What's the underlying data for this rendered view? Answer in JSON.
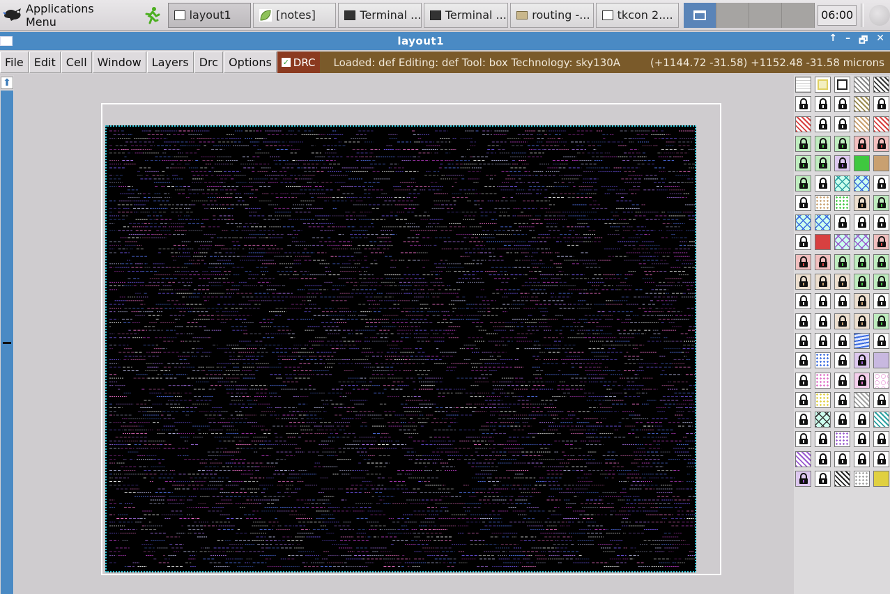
{
  "taskbar": {
    "apps_menu_label": "Applications Menu",
    "tasks": [
      {
        "label": "layout1",
        "icon": "window-icon",
        "active": true
      },
      {
        "label": "[notes]",
        "icon": "leaf-icon",
        "active": false
      },
      {
        "label": "Terminal ...",
        "icon": "terminal-icon",
        "active": false
      },
      {
        "label": "Terminal ...",
        "icon": "terminal-icon",
        "active": false
      },
      {
        "label": "routing -...",
        "icon": "folder-icon",
        "active": false
      },
      {
        "label": "tkcon 2....",
        "icon": "window-icon",
        "active": false
      }
    ],
    "clock": "06:00"
  },
  "window": {
    "title": "layout1",
    "controls": [
      "↑",
      "–",
      "🗗",
      "✕"
    ]
  },
  "menubar": {
    "items": [
      "File",
      "Edit",
      "Cell",
      "Window",
      "Layers",
      "Drc",
      "Options"
    ],
    "drc_label": "DRC",
    "drc_checked": true,
    "status_text": "Loaded: def  Editing: def  Tool: box  Technology: sky130A",
    "coords_text": "(+1144.72 -31.58) +1152.48 -31.58 microns"
  },
  "colors": {
    "titlebar": "#4a8ac4",
    "status_bg": "#7a5a2a",
    "drc_bg": "#8b3a20",
    "layout_bg": "#000000",
    "boundary": "#29c3d6"
  },
  "palette": {
    "rows": [
      [
        "grid",
        "yellow-outline",
        "black-outline",
        "light-yellow-hatch",
        "dark-hatch"
      ],
      [
        "lock",
        "lock",
        "lock",
        "olive-hatch",
        "lock"
      ],
      [
        "red-hatch",
        "lock",
        "lock",
        "tan-hatch",
        "red-hatch"
      ],
      [
        "lock-green",
        "lock-green",
        "lock-green",
        "lock-red",
        "lock-red"
      ],
      [
        "lock-green",
        "lock-green",
        "lock-purple",
        "solid-green",
        "solid-tan"
      ],
      [
        "lock-green",
        "lock",
        "cross-teal",
        "cross-blue",
        "lock"
      ],
      [
        "lock",
        "dots-tan",
        "dots-green",
        "lock-tan",
        "lock-green"
      ],
      [
        "cross-blue",
        "cross-blue",
        "lock",
        "lock",
        "lock"
      ],
      [
        "lock",
        "solid-red",
        "cross-purple",
        "cross-purple",
        "lock-red"
      ],
      [
        "lock-red",
        "lock-red",
        "lock-green",
        "lock-green",
        "lock-green"
      ],
      [
        "lock-tan",
        "lock-tan",
        "lock-tan",
        "lock-green",
        "lock-green"
      ],
      [
        "lock",
        "lock",
        "lock",
        "lock-tan",
        "lock"
      ],
      [
        "lock",
        "lock",
        "lock-tan",
        "lock-tan",
        "lock-green"
      ],
      [
        "lock",
        "lock",
        "lock",
        "wave-blue",
        "lock"
      ],
      [
        "lock",
        "dots-blue",
        "lock",
        "lock-purple",
        "solid-lavender"
      ],
      [
        "lock",
        "dots-pink",
        "lock",
        "lock-pink",
        "circles-pink"
      ],
      [
        "lock",
        "dots-yellow",
        "lock",
        "hatch-grey",
        "lock"
      ],
      [
        "lock",
        "cross-dark",
        "lock",
        "lock",
        "hatch-teal"
      ],
      [
        "lock",
        "lock",
        "dots-purple",
        "lock",
        "lock"
      ],
      [
        "hatch-purple",
        "lock",
        "lock",
        "lock",
        "lock"
      ],
      [
        "lock-purple",
        "lock",
        "hatch-black",
        "dots-grey",
        "solid-yellow"
      ]
    ]
  }
}
